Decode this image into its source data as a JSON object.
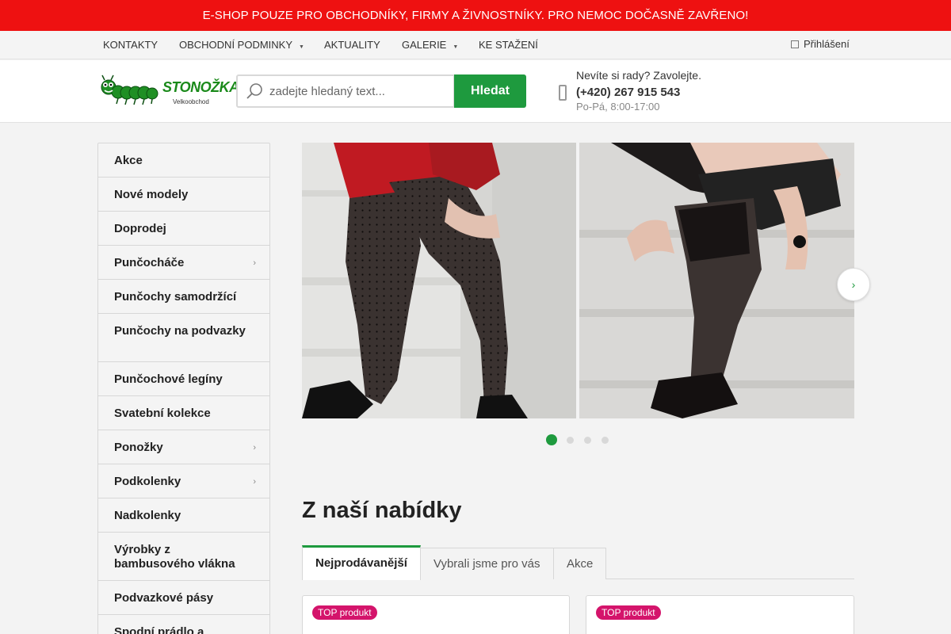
{
  "banner": {
    "text": "E-SHOP POUZE PRO OBCHODNÍKY, FIRMY A ŽIVNOSTNÍKY. PRO NEMOC DOČASNĚ ZAVŘENO!"
  },
  "topnav": {
    "items": [
      {
        "label": "KONTAKTY"
      },
      {
        "label": "OBCHODNÍ PODMINKY",
        "caret": "▼"
      },
      {
        "label": "AKTUALITY"
      },
      {
        "label": "GALERIE",
        "caret": "▼"
      },
      {
        "label": "KE STAŽENÍ"
      }
    ],
    "login_label": "Přihlášení"
  },
  "header": {
    "logo_text": "STONOŽKA",
    "logo_sub": "Velkoobchod",
    "search_placeholder": "zadejte hledaný text...",
    "search_button": "Hledat",
    "help_label": "Nevíte si rady? Zavolejte.",
    "help_phone": "(+420) 267 915 543",
    "help_hours": "Po-Pá, 8:00-17:00"
  },
  "sidebar": {
    "items": [
      {
        "label": "Akce"
      },
      {
        "label": "Nové modely"
      },
      {
        "label": "Doprodej"
      },
      {
        "label": "Punčocháče",
        "arrow": "›"
      },
      {
        "label": "Punčochy samodržící"
      },
      {
        "label": "Punčochy na podvazky"
      },
      {
        "label": "Punčochové legíny"
      },
      {
        "label": "Svatební kolekce"
      },
      {
        "label": "Ponožky",
        "arrow": "›"
      },
      {
        "label": "Podkolenky",
        "arrow": "›"
      },
      {
        "label": "Nadkolenky"
      },
      {
        "label": "Výrobky z bambusového vlákna"
      },
      {
        "label": "Podvazkové pásy"
      },
      {
        "label": "Spodní prádlo a"
      }
    ]
  },
  "slider": {
    "next_icon": "›",
    "dots": 4,
    "active_index": 0
  },
  "offers": {
    "title": "Z naší nabídky",
    "tabs": [
      {
        "label": "Nejprodávanější",
        "active": true
      },
      {
        "label": "Vybrali jsme pro vás",
        "active": false
      },
      {
        "label": "Akce",
        "active": false
      }
    ],
    "cards": [
      {
        "badge": "TOP produkt"
      },
      {
        "badge": "TOP produkt"
      }
    ]
  },
  "colors": {
    "banner": "#ee1111",
    "accent": "#1e9a3e",
    "badge": "#d4146b"
  }
}
